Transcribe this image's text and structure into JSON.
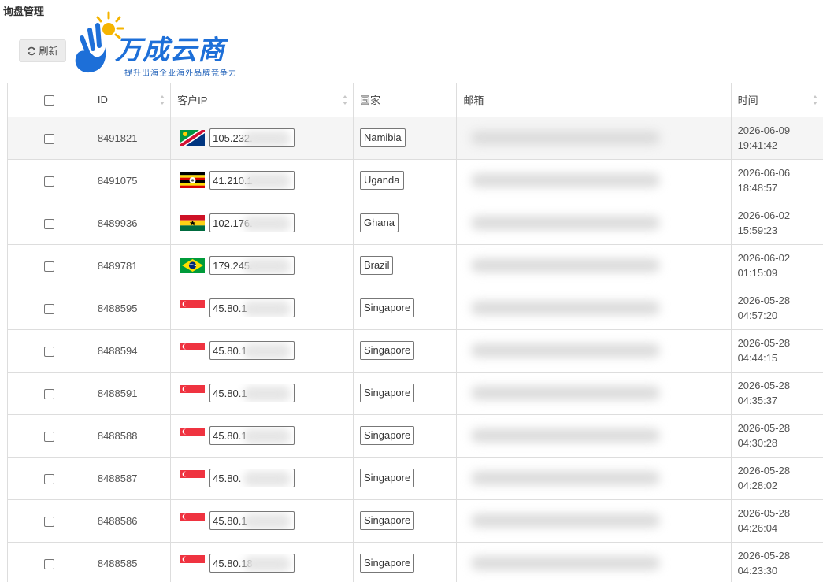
{
  "header": {
    "title": "询盘管理"
  },
  "toolbar": {
    "refresh_label": "刷新"
  },
  "logo": {
    "text": "万成云商",
    "slogan": "提升出海企业海外品牌竞争力"
  },
  "table": {
    "columns": {
      "id": "ID",
      "ip": "客户IP",
      "country": "国家",
      "email": "邮箱",
      "time": "时间"
    },
    "rows": [
      {
        "id": "8491821",
        "flag": "namibia",
        "ip": "105.232.",
        "country": "Namibia",
        "date": "2026-06-09",
        "clock": "19:41:42"
      },
      {
        "id": "8491075",
        "flag": "uganda",
        "ip": "41.210.1",
        "country": "Uganda",
        "date": "2026-06-06",
        "clock": "18:48:57"
      },
      {
        "id": "8489936",
        "flag": "ghana",
        "ip": "102.176.",
        "country": "Ghana",
        "date": "2026-06-02",
        "clock": "15:59:23"
      },
      {
        "id": "8489781",
        "flag": "brazil",
        "ip": "179.245.",
        "country": "Brazil",
        "date": "2026-06-02",
        "clock": "01:15:09"
      },
      {
        "id": "8488595",
        "flag": "singapore",
        "ip": "45.80.1",
        "country": "Singapore",
        "date": "2026-05-28",
        "clock": "04:57:20"
      },
      {
        "id": "8488594",
        "flag": "singapore",
        "ip": "45.80.1",
        "country": "Singapore",
        "date": "2026-05-28",
        "clock": "04:44:15"
      },
      {
        "id": "8488591",
        "flag": "singapore",
        "ip": "45.80.1",
        "country": "Singapore",
        "date": "2026-05-28",
        "clock": "04:35:37"
      },
      {
        "id": "8488588",
        "flag": "singapore",
        "ip": "45.80.1",
        "country": "Singapore",
        "date": "2026-05-28",
        "clock": "04:30:28"
      },
      {
        "id": "8488587",
        "flag": "singapore",
        "ip": "45.80.",
        "country": "Singapore",
        "date": "2026-05-28",
        "clock": "04:28:02"
      },
      {
        "id": "8488586",
        "flag": "singapore",
        "ip": "45.80.1",
        "country": "Singapore",
        "date": "2026-05-28",
        "clock": "04:26:04"
      },
      {
        "id": "8488585",
        "flag": "singapore",
        "ip": "45.80.18",
        "country": "Singapore",
        "date": "2026-05-28",
        "clock": "04:23:30"
      }
    ]
  }
}
